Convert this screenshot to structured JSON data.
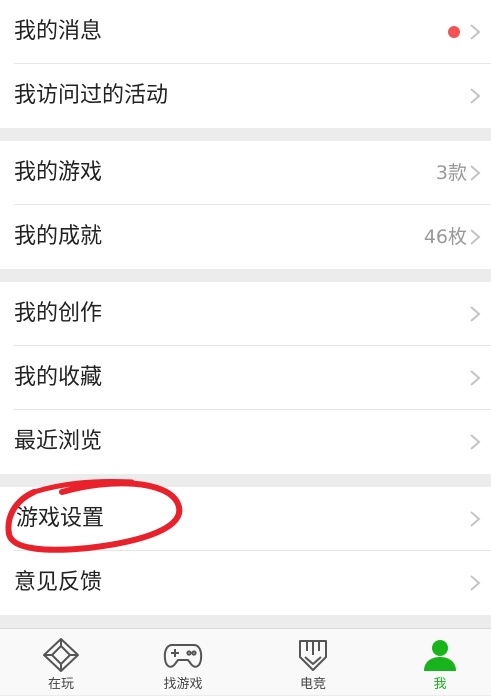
{
  "menu": {
    "groups": [
      [
        {
          "label": "我的消息",
          "value": "",
          "badge_dot": true
        },
        {
          "label": "我访问过的活动",
          "value": "",
          "badge_dot": false
        }
      ],
      [
        {
          "label": "我的游戏",
          "value": "3款",
          "badge_dot": false
        },
        {
          "label": "我的成就",
          "value": "46枚",
          "badge_dot": false
        }
      ],
      [
        {
          "label": "我的创作",
          "value": "",
          "badge_dot": false
        },
        {
          "label": "我的收藏",
          "value": "",
          "badge_dot": false
        },
        {
          "label": "最近浏览",
          "value": "",
          "badge_dot": false
        }
      ],
      [
        {
          "label": "游戏设置",
          "value": "",
          "badge_dot": false
        },
        {
          "label": "意见反馈",
          "value": "",
          "badge_dot": false
        }
      ]
    ]
  },
  "tabbar": {
    "tabs": [
      {
        "label": "在玩",
        "icon": "playing-icon",
        "active": false
      },
      {
        "label": "找游戏",
        "icon": "gamepad-icon",
        "active": false
      },
      {
        "label": "电竞",
        "icon": "esports-icon",
        "active": false
      },
      {
        "label": "我",
        "icon": "profile-icon",
        "active": true
      }
    ]
  },
  "colors": {
    "accent": "#19b41b",
    "badge": "#f25353",
    "annotation": "#e8212a",
    "separator": "#ececec"
  }
}
